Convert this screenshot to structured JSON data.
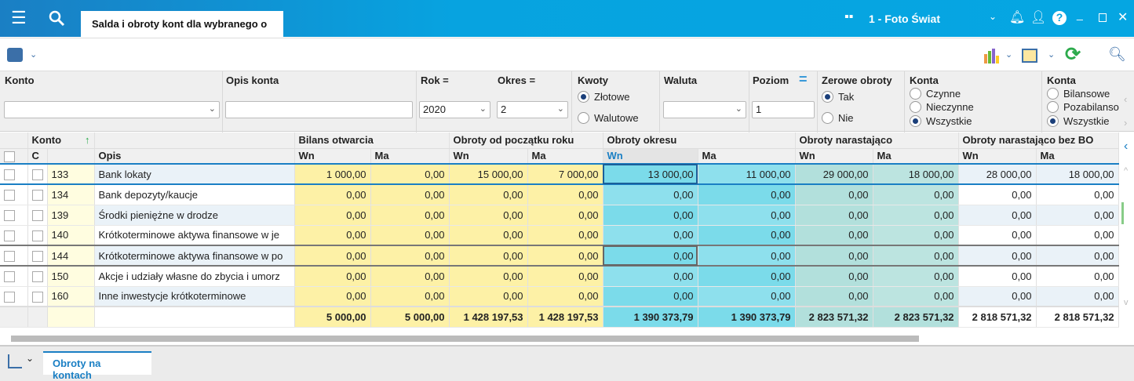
{
  "window": {
    "tab_title": "Salda i obroty kont dla wybranego o",
    "company": "1 - Foto Świat",
    "icons": [
      "menu-icon",
      "search-icon",
      "grid-icon",
      "bell-icon",
      "user-icon",
      "help-icon",
      "minimize-icon",
      "maximize-icon",
      "close-icon"
    ]
  },
  "filters": {
    "konto": {
      "label": "Konto",
      "value": ""
    },
    "opis": {
      "label": "Opis konta",
      "value": ""
    },
    "rok": {
      "label": "Rok =",
      "value": "2020"
    },
    "okres": {
      "label": "Okres =",
      "value": "2"
    },
    "kwoty": {
      "label": "Kwoty",
      "options": [
        "Złotowe",
        "Walutowe"
      ],
      "selected": "Złotowe"
    },
    "waluta": {
      "label": "Waluta",
      "value": ""
    },
    "poziom": {
      "label": "Poziom",
      "value": "1"
    },
    "zerowe": {
      "label": "Zerowe obroty",
      "options": [
        "Tak",
        "Nie"
      ],
      "selected": "Tak"
    },
    "konta1": {
      "label": "Konta",
      "options": [
        "Czynne",
        "Nieczynne",
        "Wszystkie"
      ],
      "selected": "Wszystkie"
    },
    "konta2": {
      "label": "Konta",
      "options": [
        "Bilansowe",
        "Pozabilanso",
        "Wszystkie"
      ],
      "selected": "Wszystkie"
    }
  },
  "grid": {
    "groups": {
      "konto": "Konto",
      "bo": "Bilans otwarcia",
      "op": "Obroty od początku roku",
      "oo": "Obroty okresu",
      "on": "Obroty narastająco",
      "onb": "Obroty narastająco bez BO"
    },
    "sub": {
      "c": "C",
      "opis": "Opis",
      "wn": "Wn",
      "ma": "Ma"
    },
    "rows": [
      [
        "133",
        "Bank lokaty",
        "1 000,00",
        "0,00",
        "15 000,00",
        "7 000,00",
        "13 000,00",
        "11 000,00",
        "29 000,00",
        "18 000,00",
        "28 000,00",
        "18 000,00"
      ],
      [
        "134",
        "Bank depozyty/kaucje",
        "0,00",
        "0,00",
        "0,00",
        "0,00",
        "0,00",
        "0,00",
        "0,00",
        "0,00",
        "0,00",
        "0,00"
      ],
      [
        "139",
        "Środki pieniężne w drodze",
        "0,00",
        "0,00",
        "0,00",
        "0,00",
        "0,00",
        "0,00",
        "0,00",
        "0,00",
        "0,00",
        "0,00"
      ],
      [
        "140",
        "Krótkoterminowe aktywa finansowe w je",
        "0,00",
        "0,00",
        "0,00",
        "0,00",
        "0,00",
        "0,00",
        "0,00",
        "0,00",
        "0,00",
        "0,00"
      ],
      [
        "144",
        "Krótkoterminowe aktywa finansowe w po",
        "0,00",
        "0,00",
        "0,00",
        "0,00",
        "0,00",
        "0,00",
        "0,00",
        "0,00",
        "0,00",
        "0,00"
      ],
      [
        "150",
        "Akcje i udziały własne do zbycia i umorz",
        "0,00",
        "0,00",
        "0,00",
        "0,00",
        "0,00",
        "0,00",
        "0,00",
        "0,00",
        "0,00",
        "0,00"
      ],
      [
        "160",
        "Inne inwestycje krótkoterminowe",
        "0,00",
        "0,00",
        "0,00",
        "0,00",
        "0,00",
        "0,00",
        "0,00",
        "0,00",
        "0,00",
        "0,00"
      ]
    ],
    "totals": [
      "5 000,00",
      "5 000,00",
      "1 428 197,53",
      "1 428 197,53",
      "1 390 373,79",
      "1 390 373,79",
      "2 823 571,32",
      "2 823 571,32",
      "2 818 571,32",
      "2 818 571,32"
    ]
  },
  "bottom": {
    "tab": "Obroty na kontach"
  }
}
